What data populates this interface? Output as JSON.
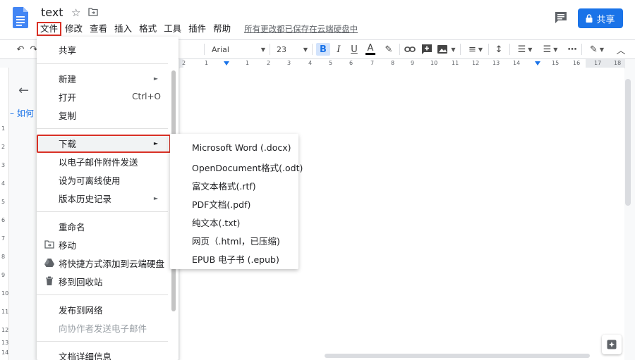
{
  "doc": {
    "title": "text"
  },
  "menubar": {
    "items": [
      "文件",
      "修改",
      "查看",
      "插入",
      "格式",
      "工具",
      "插件",
      "帮助"
    ],
    "save_status": "所有更改都已保存在云端硬盘中"
  },
  "header": {
    "share_label": "共享"
  },
  "toolbar": {
    "font": "Arial",
    "font_size": "23"
  },
  "ruler": {
    "numbers": [
      "2",
      "1",
      "1",
      "2",
      "3",
      "4",
      "5",
      "6",
      "7",
      "8",
      "9",
      "10",
      "11",
      "12",
      "13",
      "14",
      "15",
      "16",
      "17",
      "18"
    ]
  },
  "vruler": {
    "numbers": [
      "1",
      "2",
      "3",
      "4",
      "5",
      "6",
      "7",
      "8",
      "9",
      "10",
      "11",
      "12",
      "13",
      "14"
    ]
  },
  "outline": {
    "item": "如何"
  },
  "file_menu": {
    "share": "共享",
    "new": "新建",
    "open": "打开",
    "open_shortcut": "Ctrl+O",
    "copy": "复制",
    "download": "下载",
    "email_attach": "以电子邮件附件发送",
    "offline": "设为可离线使用",
    "version_history": "版本历史记录",
    "rename": "重命名",
    "move": "移动",
    "add_shortcut": "将快捷方式添加到云端硬盘",
    "trash": "移到回收站",
    "publish": "发布到网络",
    "email_collab": "向协作者发送电子邮件",
    "doc_details": "文档详细信息"
  },
  "download_menu": {
    "items": [
      "Microsoft Word (.docx)",
      "OpenDocument格式(.odt)",
      "富文本格式(.rtf)",
      "PDF文档(.pdf)",
      "纯文本(.txt)",
      "网页（.html，已压缩)",
      "EPUB 电子书 (.epub)"
    ]
  },
  "colors": {
    "accent": "#1a73e8",
    "highlight_border": "#d93025"
  }
}
